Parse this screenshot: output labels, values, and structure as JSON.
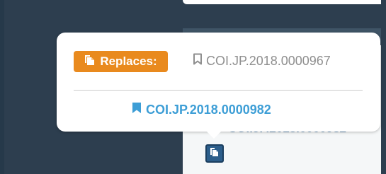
{
  "colors": {
    "background_dark": "#2d3e4f",
    "badge_orange": "#e98a1e",
    "link_blue": "#3d9ed6",
    "muted_gray": "#8f8f8f",
    "icon_button_blue": "#2c5e8b"
  },
  "popover": {
    "badge": {
      "label": "Replaces:",
      "icon": "document-copy-icon"
    },
    "replaced_identifier": {
      "text": "COI.JP.2018.0000967",
      "icon": "bookmark-outline-icon"
    },
    "current_identifier": {
      "text": "COI.JP.2018.0000982",
      "icon": "bookmark-filled-icon"
    }
  },
  "background": {
    "identifier_link": "COI.JP.2018.0000982",
    "button_icon": "document-copy-icon"
  }
}
